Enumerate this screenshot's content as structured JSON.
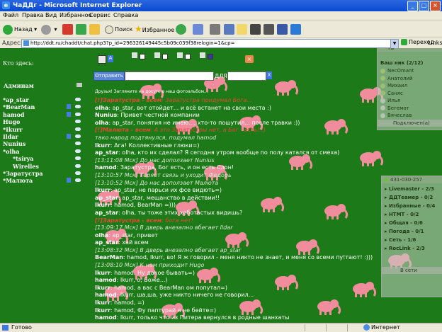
{
  "window": {
    "title": "ЧаДДг - Microsoft Internet Explorer",
    "controls": [
      "_",
      "□",
      "×"
    ]
  },
  "menu": [
    "Файл",
    "Правка",
    "Вид",
    "Избранное",
    "Сервис",
    "Справка"
  ],
  "toolbar": {
    "back": "Назад",
    "search": "Поиск",
    "favorites": "Избранное"
  },
  "address": {
    "label": "Адрес:",
    "url": "http://ddt.ru/chaddt/chat.php3?p_id=296326149445c5b09c039f38relogin=1&cp=",
    "go": "Переход",
    "links": "Links"
  },
  "status": {
    "text": "Готово",
    "zone": "Интернет"
  },
  "chat_page": {
    "who_here": "Кто здесь:",
    "admins_label": "Админам",
    "top_letter": "A",
    "send_button": "Отправить",
    "message_value": "",
    "for_label": "ДЛЯ",
    "recipient_value": "",
    "x_label": "X",
    "close_label": "×",
    "notice": "Друзья! Загляните на досуге в наш фотоальбом...",
    "users": [
      {
        "name": "*ap_star",
        "info": false
      },
      {
        "name": "*BearMan",
        "info": true
      },
      {
        "name": "hamod",
        "info": true
      },
      {
        "name": "Hugo",
        "info": false
      },
      {
        "name": "*Ikurr",
        "info": false
      },
      {
        "name": "Ildar",
        "info": true
      },
      {
        "name": "Nunius",
        "info": false
      },
      {
        "name": "*olha",
        "info": false
      },
      {
        "name": "*tsirya",
        "info": false
      },
      {
        "name": "Wirelles",
        "info": false
      },
      {
        "name": "*Заратустра",
        "info": false
      },
      {
        "name": "*Малюта",
        "info": true
      }
    ],
    "messages": [
      {
        "kind": "ev",
        "who": "[!]Заратустра - всем",
        "text": ": Заратустра придумал Бога..."
      },
      {
        "kind": "msg",
        "who": "olha",
        "text": ": ap_star, вот отойдет... и всё встанет на свои места :)"
      },
      {
        "kind": "msg",
        "who": "Nunius",
        "text": ": Привет честной компании"
      },
      {
        "kind": "msg",
        "who": "olha",
        "text": ": ap_star, понятия не имею.... хто-то пошутил... после травки :))"
      },
      {
        "kind": "ev",
        "who": "[!]Малюта - всем",
        "text": ": А это Заратустры нет, а Бог - есть! :)"
      },
      {
        "kind": "sys",
        "who": "",
        "text": "тако народ подтянулся, подумал hamod"
      },
      {
        "kind": "msg",
        "who": "Ikurr",
        "text": ": Ага! Коллективные глюки=)"
      },
      {
        "kind": "msg",
        "who": "ap_star",
        "text": ": olha, кто их сделал? Я сегодня утром вообще по полу катался от смеха)"
      },
      {
        "kind": "sys",
        "who": "",
        "text": "[13:11:08 Мск] До нас доползает Nunius"
      },
      {
        "kind": "msg",
        "who": "hamod",
        "text": ": Заратустра, Бог есть, и он есть Слон!"
      },
      {
        "kind": "sys",
        "who": "",
        "text": "[13:10:57 Мск] Теряет связь и уходит Федорь"
      },
      {
        "kind": "sys",
        "who": "",
        "text": "[13:10:52 Мск] До нас доползает Малюта"
      },
      {
        "kind": "msg",
        "who": "Ikurr",
        "text": ": ap_star, не парьси их фсе видють=)"
      },
      {
        "kind": "msg",
        "who": "ap_star",
        "text": ": ap_star, мещанство в действии!!"
      },
      {
        "kind": "msg",
        "who": "Ikurr",
        "text": ": hamod, BearMan =)))"
      },
      {
        "kind": "msg",
        "who": "ap_star",
        "text": ": olha, ты тоже этих хоботастых видишь?"
      },
      {
        "kind": "ev",
        "who": "[!]Заратустра - всем",
        "text": ": бога нет!"
      },
      {
        "kind": "sys",
        "who": "",
        "text": "[13:09:17 Мск] В дверь внезапно вбегает Ildar"
      },
      {
        "kind": "msg",
        "who": "olha",
        "text": ": ap_star, привет"
      },
      {
        "kind": "msg",
        "who": "ap_star",
        "text": ": хай всем"
      },
      {
        "kind": "sys",
        "who": "",
        "text": "[13:08:32 Мск] В дверь внезапно вбегает ap_star"
      },
      {
        "kind": "msg",
        "who": "BearMan",
        "text": ": hamod, Ikurr, во! Я ж говорил - меня никто не знает, и меня со всеми пу!тают! :)))"
      },
      {
        "kind": "sys",
        "who": "",
        "text": "[13:08:10 Мск] К нам приходит Hugo"
      },
      {
        "kind": "msg",
        "who": "Ikurr",
        "text": ": hamod, Ну дакое бывать=)"
      },
      {
        "kind": "msg",
        "who": "hamod",
        "text": ": Ikurr, о, Боже...)"
      },
      {
        "kind": "msg",
        "who": "Ikurr",
        "text": ": hamod, а вас с BearMan ом попутал=)"
      },
      {
        "kind": "msg",
        "who": "hamod",
        "text": ": Ikurr, ша,ша, уже никто ничего не говорил..."
      },
      {
        "kind": "msg",
        "who": "Ikurr",
        "text": ": hamod, =)"
      },
      {
        "kind": "msg",
        "who": "Ikurr",
        "text": ": hamod, Фу паптурай я не бейте=)"
      },
      {
        "kind": "msg",
        "who": "hamod",
        "text": ": Ikurr, только что из Питера вернулся в родные шанхаты"
      }
    ]
  },
  "im_panel_1": {
    "header": "Ты",
    "contacts_header": "Ваш ник (2/12)",
    "contacts": [
      "NecOmant",
      "Анатолий",
      "Михаил",
      "Саняс",
      "Илья",
      "Бегемот",
      "Вячеслав"
    ],
    "footer": "Подключен(а)"
  },
  "im_panel_2": {
    "header": "431-030-257",
    "groups": [
      "Livemaster - 2/3",
      "ДДТеамер - 0/2",
      "Избранные - 0/4",
      "НТМТ - 0/2",
      "Общая - 0/6",
      "Погода - 0/1",
      "Сеть - 1/6",
      "RocLink - 2/3"
    ],
    "footer": "В сети"
  },
  "colors": {
    "page_bg": "#1c7a18",
    "elephant": "#f08c9c",
    "event_text": "#e14a35",
    "title_blue": "#0a4bd0"
  }
}
